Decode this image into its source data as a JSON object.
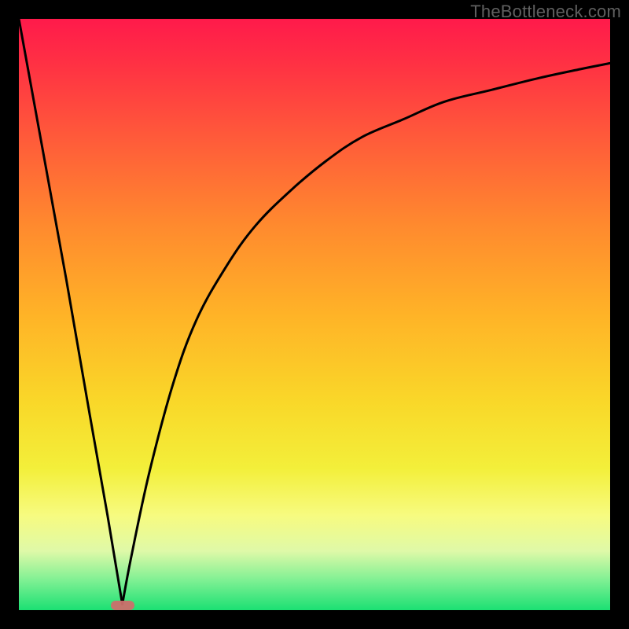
{
  "attribution": "TheBottleneck.com",
  "colors": {
    "frame": "#000000",
    "gradient_top": "#ff1a4b",
    "gradient_bottom": "#1be073",
    "curve": "#000000",
    "marker": "#cc6f6c"
  },
  "chart_data": {
    "type": "line",
    "title": "",
    "xlabel": "",
    "ylabel": "",
    "xlim": [
      0,
      100
    ],
    "ylim": [
      0,
      100
    ],
    "series": [
      {
        "name": "left-branch",
        "x": [
          0,
          4,
          8,
          12,
          15,
          17.5
        ],
        "values": [
          100,
          78,
          56,
          33,
          16,
          1
        ]
      },
      {
        "name": "right-branch",
        "x": [
          17.5,
          19,
          22,
          26,
          30,
          35,
          40,
          46,
          52,
          58,
          65,
          72,
          80,
          88,
          95,
          100
        ],
        "values": [
          1,
          9,
          23,
          38,
          49,
          58,
          65,
          71,
          76,
          80,
          83,
          86,
          88,
          90,
          91.5,
          92.5
        ]
      }
    ],
    "marker": {
      "x": 17.5,
      "y": 0.8
    },
    "grid": false,
    "legend": false
  }
}
